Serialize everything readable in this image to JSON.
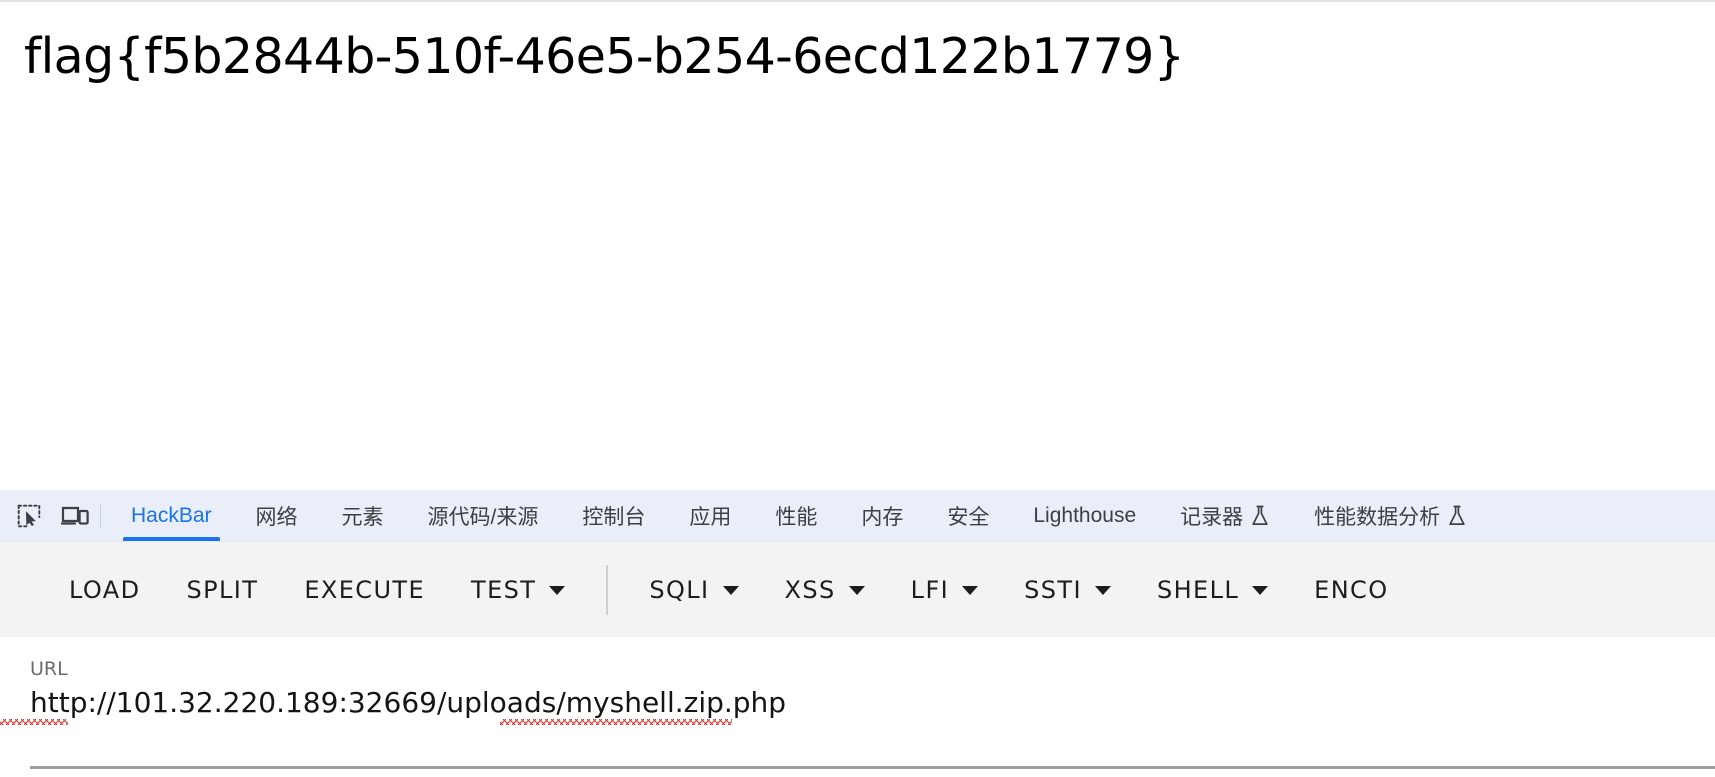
{
  "page": {
    "flag_text": "flag{f5b2844b-510f-46e5-b254-6ecd122b1779}"
  },
  "devtools": {
    "icons": [
      {
        "name": "inspect-element-icon",
        "label": "Inspect element"
      },
      {
        "name": "device-toolbar-icon",
        "label": "Toggle device toolbar"
      }
    ],
    "tabs": [
      {
        "label": "HackBar",
        "active": true,
        "flask": false
      },
      {
        "label": "网络",
        "active": false,
        "flask": false
      },
      {
        "label": "元素",
        "active": false,
        "flask": false
      },
      {
        "label": "源代码/来源",
        "active": false,
        "flask": false
      },
      {
        "label": "控制台",
        "active": false,
        "flask": false
      },
      {
        "label": "应用",
        "active": false,
        "flask": false
      },
      {
        "label": "性能",
        "active": false,
        "flask": false
      },
      {
        "label": "内存",
        "active": false,
        "flask": false
      },
      {
        "label": "安全",
        "active": false,
        "flask": false
      },
      {
        "label": "Lighthouse",
        "active": false,
        "flask": false
      },
      {
        "label": "记录器",
        "active": false,
        "flask": true
      },
      {
        "label": "性能数据分析",
        "active": false,
        "flask": true
      }
    ],
    "active_tab": "HackBar",
    "accent_color": "#1a73e8",
    "tabbar_background": "#eaeef8"
  },
  "hackbar": {
    "toolbar_background": "#f3f3f3",
    "buttons_group_1": [
      {
        "label": "LOAD",
        "has_caret": false
      },
      {
        "label": "SPLIT",
        "has_caret": false
      },
      {
        "label": "EXECUTE",
        "has_caret": false
      },
      {
        "label": "TEST",
        "has_caret": true
      }
    ],
    "buttons_group_2": [
      {
        "label": "SQLI",
        "has_caret": true
      },
      {
        "label": "XSS",
        "has_caret": true
      },
      {
        "label": "LFI",
        "has_caret": true
      },
      {
        "label": "SSTI",
        "has_caret": true
      },
      {
        "label": "SHELL",
        "has_caret": true
      },
      {
        "label": "ENCO",
        "has_caret": false
      }
    ],
    "url_field": {
      "label": "URL",
      "value": "http://101.32.220.189:32669/uploads/myshell.zip.php",
      "placeholder": "URL"
    }
  }
}
